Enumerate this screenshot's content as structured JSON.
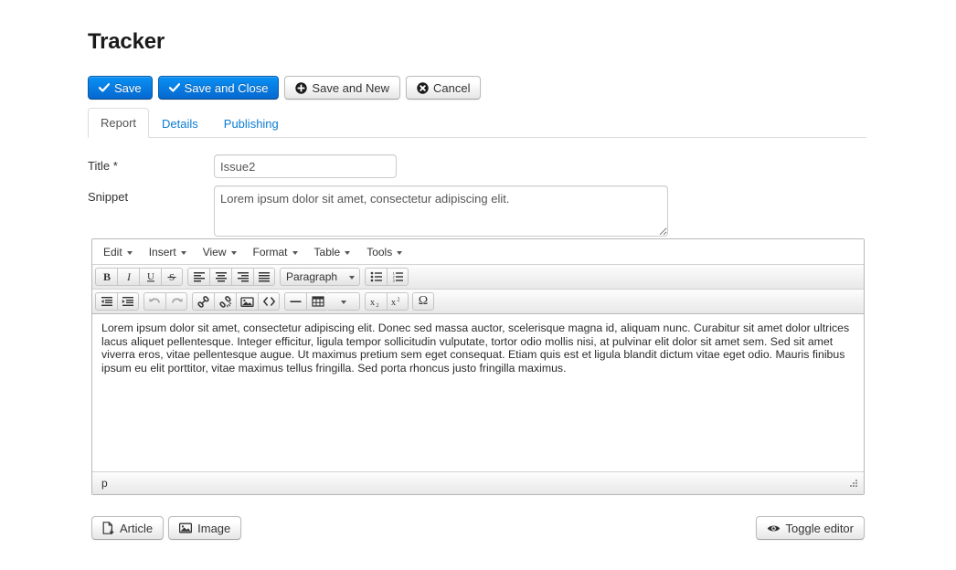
{
  "page": {
    "title": "Tracker"
  },
  "toolbar": {
    "buttons": [
      {
        "label": "Save",
        "icon": "check-icon",
        "style": "primary",
        "name": "save-button"
      },
      {
        "label": "Save and Close",
        "icon": "check-icon",
        "style": "primary",
        "name": "save-and-close-button"
      },
      {
        "label": "Save and New",
        "icon": "plus-circle-icon",
        "style": "default",
        "name": "save-and-new-button"
      },
      {
        "label": "Cancel",
        "icon": "x-circle-icon",
        "style": "default",
        "name": "cancel-button"
      }
    ]
  },
  "tabs": {
    "items": [
      {
        "label": "Report",
        "active": true
      },
      {
        "label": "Details",
        "active": false
      },
      {
        "label": "Publishing",
        "active": false
      }
    ]
  },
  "form": {
    "title_field": {
      "label": "Title *",
      "value": "Issue2",
      "placeholder": ""
    },
    "snippet_field": {
      "label": "Snippet",
      "value": "Lorem ipsum dolor sit amet, consectetur adipiscing elit.",
      "placeholder": ""
    }
  },
  "editor": {
    "menubar": [
      {
        "label": "Edit"
      },
      {
        "label": "Insert"
      },
      {
        "label": "View"
      },
      {
        "label": "Format"
      },
      {
        "label": "Table"
      },
      {
        "label": "Tools"
      }
    ],
    "toolbar_row1": {
      "format_group": [
        "bold-icon",
        "italic-icon",
        "underline-icon",
        "strikethrough-icon"
      ],
      "align_group": [
        "align-left-icon",
        "align-center-icon",
        "align-right-icon",
        "align-justify-icon"
      ],
      "block_format": "Paragraph",
      "list_group": [
        "bullet-list-icon",
        "numbered-list-icon"
      ]
    },
    "toolbar_row2": {
      "indent_group": [
        "outdent-icon",
        "indent-icon"
      ],
      "history_group": [
        "undo-icon",
        "redo-icon"
      ],
      "insert_group": [
        "link-icon",
        "unlink-icon",
        "image-icon",
        "source-code-icon"
      ],
      "object_group": [
        "horizontal-rule-icon",
        "table-icon"
      ],
      "script_group": [
        "subscript-icon",
        "superscript-icon"
      ],
      "special_char": "Ω"
    },
    "content": "Lorem ipsum dolor sit amet, consectetur adipiscing elit. Donec sed massa auctor, scelerisque magna id, aliquam nunc. Curabitur sit amet dolor ultrices lacus aliquet pellentesque. Integer efficitur, ligula tempor sollicitudin vulputate, tortor odio mollis nisi, at pulvinar elit dolor sit amet sem. Sed sit amet viverra eros, vitae pellentesque augue. Ut maximus pretium sem eget consequat. Etiam quis est et ligula blandit dictum vitae eget odio. Mauris finibus ipsum eu elit porttitor, vitae maximus tellus fringilla. Sed porta rhoncus justo fringilla maximus.",
    "statusbar_path": "p"
  },
  "bottom": {
    "article_button": {
      "label": "Article",
      "icon": "article-insert-icon"
    },
    "image_button": {
      "label": "Image",
      "icon": "image-icon"
    },
    "toggle_editor_button": {
      "label": "Toggle editor",
      "icon": "eye-icon"
    }
  },
  "colors": {
    "primary": "#0668cf",
    "link": "#0b7cd4",
    "text": "#333333",
    "border": "#cccccc"
  }
}
